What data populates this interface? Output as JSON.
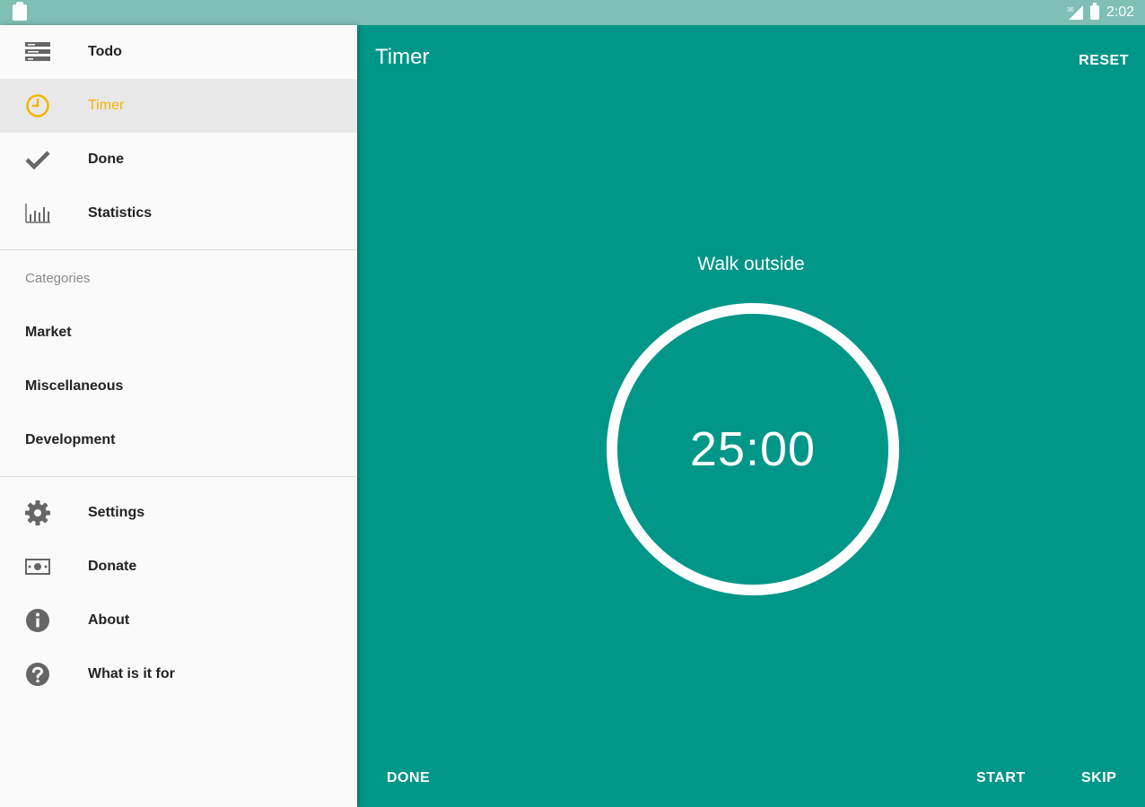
{
  "status_bar": {
    "time": "2:02",
    "icons": [
      "clipboard-icon",
      "signal-icon",
      "battery-icon"
    ]
  },
  "drawer": {
    "nav": [
      {
        "label": "Todo",
        "icon": "list-icon"
      },
      {
        "label": "Timer",
        "icon": "clock-icon",
        "active": true
      },
      {
        "label": "Done",
        "icon": "check-icon"
      },
      {
        "label": "Statistics",
        "icon": "bar-chart-icon"
      }
    ],
    "categories_header": "Categories",
    "categories": [
      "Market",
      "Miscellaneous",
      "Development"
    ],
    "bottom_nav": [
      {
        "label": "Settings",
        "icon": "gear-icon"
      },
      {
        "label": "Donate",
        "icon": "money-icon"
      },
      {
        "label": "About",
        "icon": "info-icon"
      },
      {
        "label": "What is it for",
        "icon": "help-icon"
      }
    ]
  },
  "main": {
    "title": "Timer",
    "reset_label": "RESET",
    "task_name": "Walk outside",
    "timer": "25:00",
    "done_label": "DONE",
    "start_label": "START",
    "skip_label": "SKIP"
  },
  "colors": {
    "primary": "#009688",
    "accent": "#f5b400",
    "status_bar": "#7fbfb4"
  }
}
